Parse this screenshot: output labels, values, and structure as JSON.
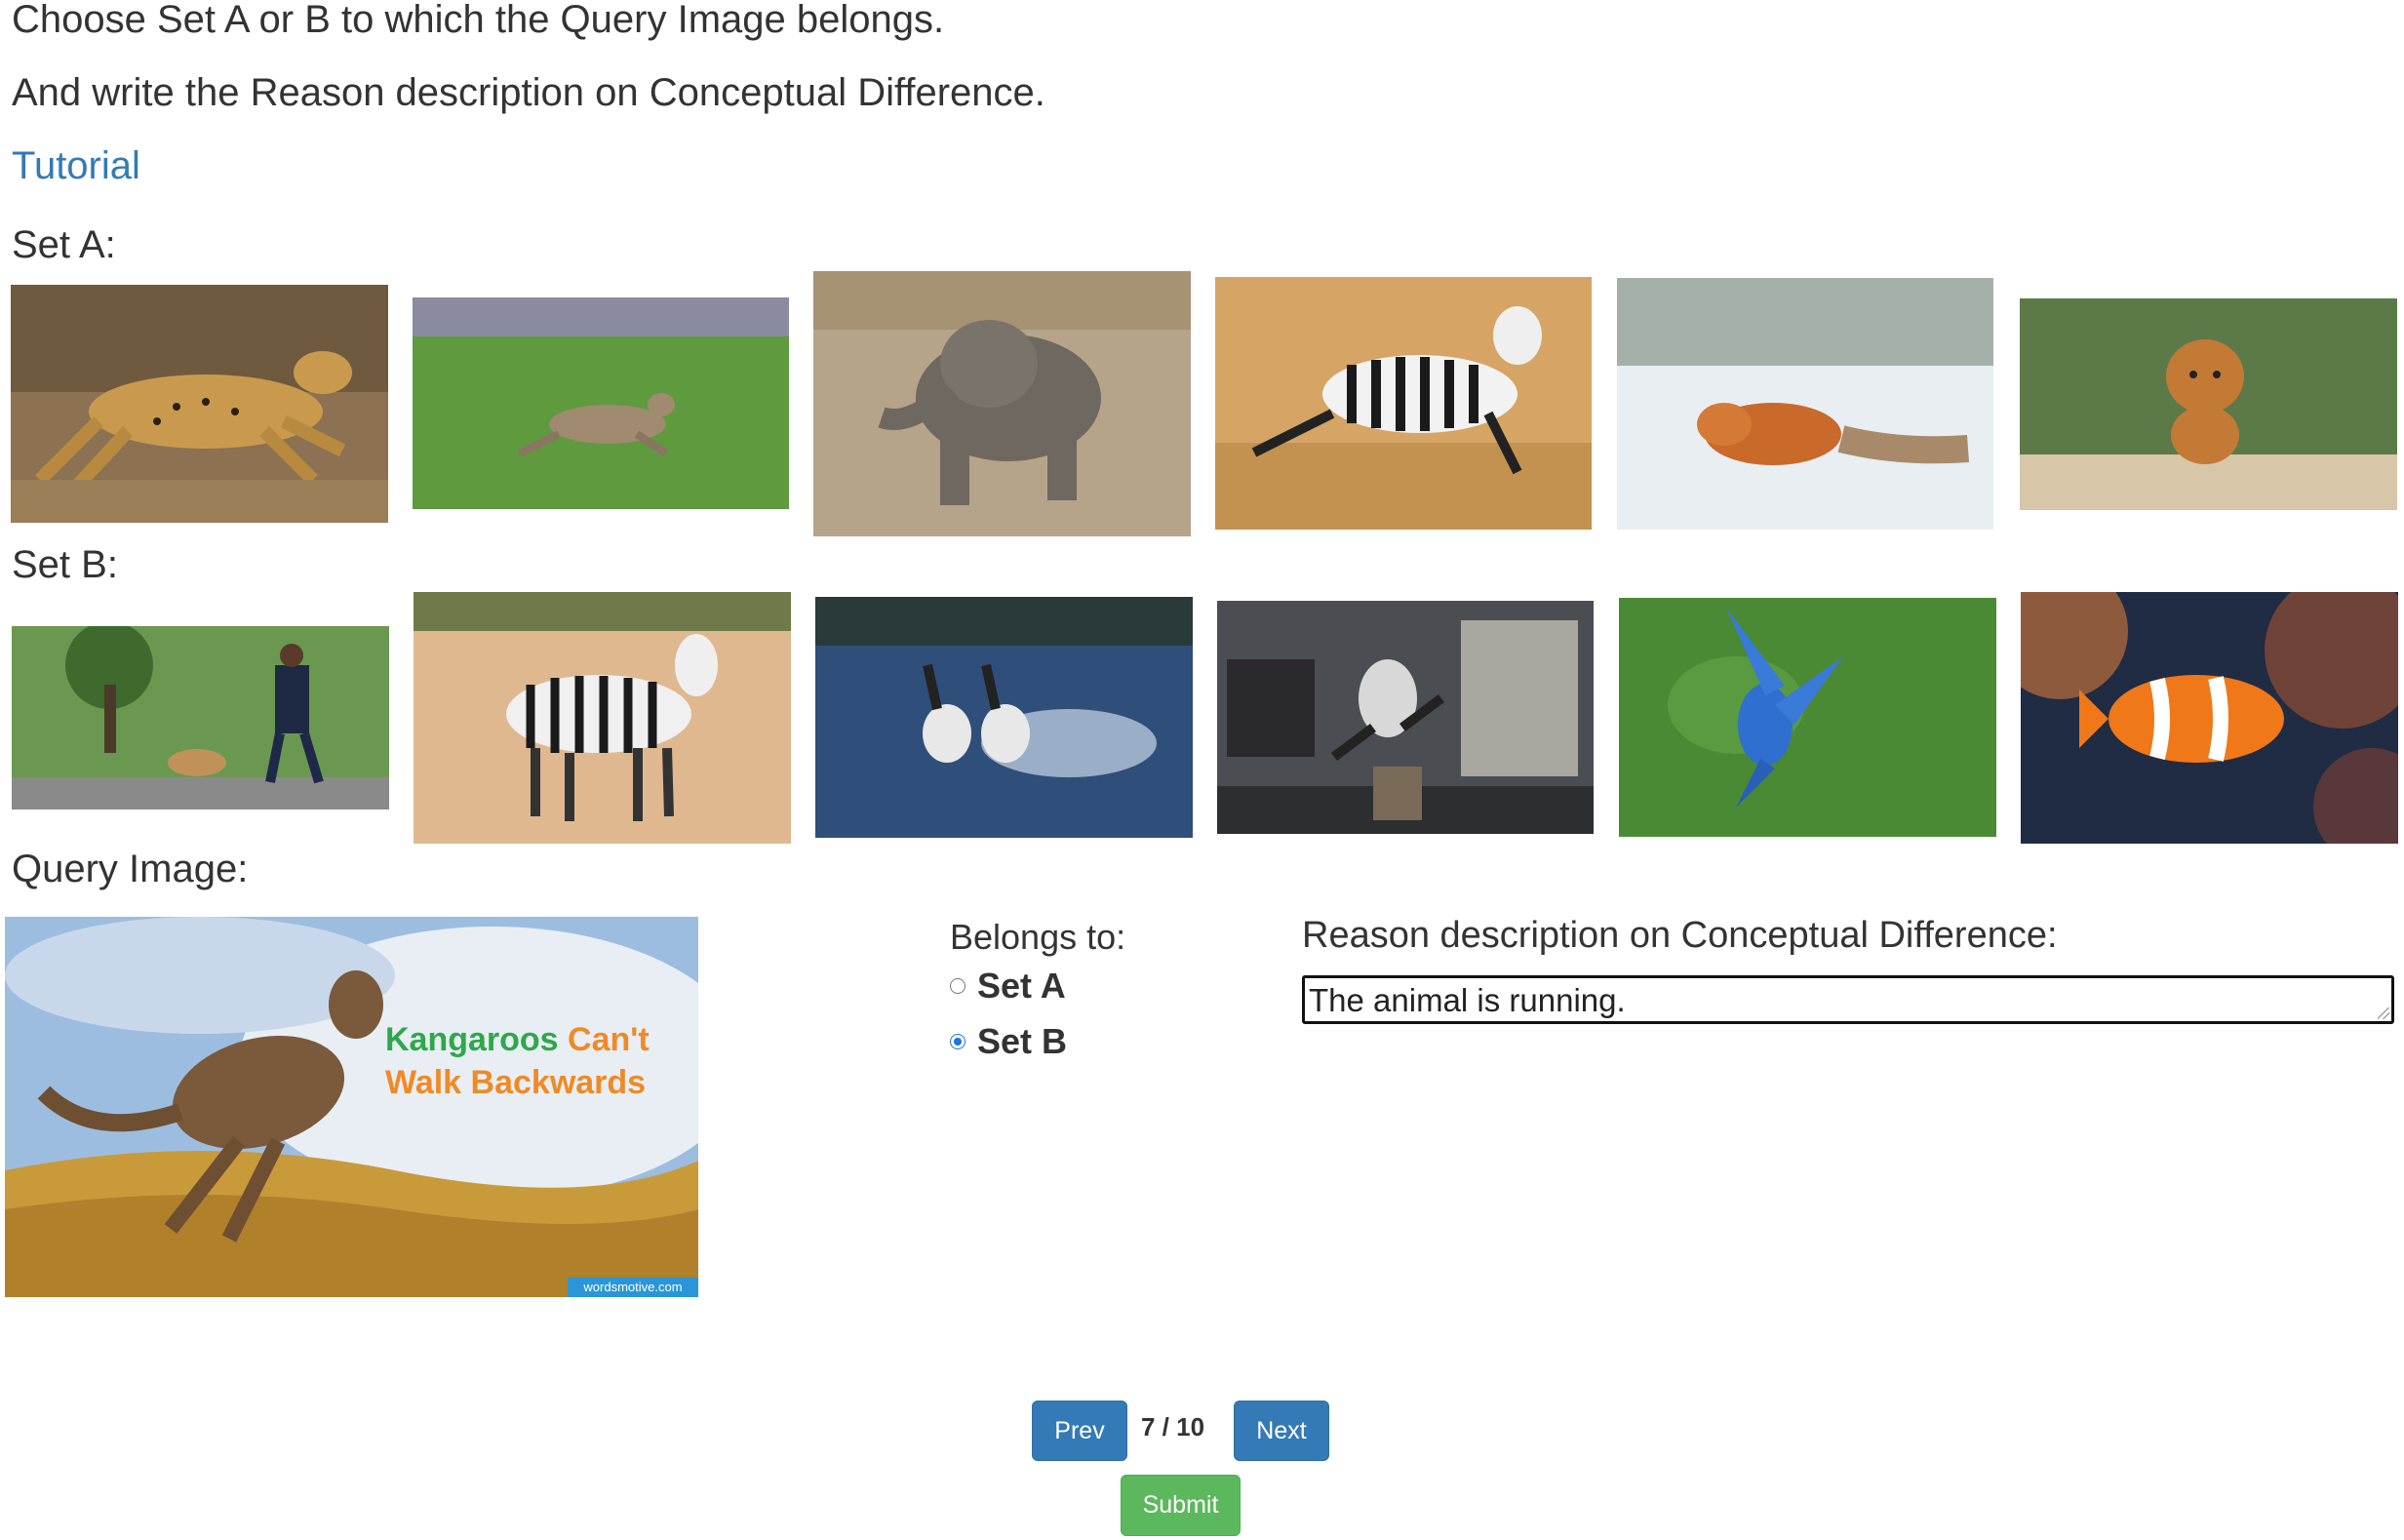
{
  "instructions": {
    "line1": "Choose Set A or B to which the Query Image belongs.",
    "line2": "And write the Reason description on Conceptual Difference."
  },
  "tutorial_link": "Tutorial",
  "set_a": {
    "label": "Set A:",
    "images": [
      "cheetah running",
      "deer running",
      "baby elephant running",
      "zebra leaping",
      "fox running in snow",
      "dog running"
    ]
  },
  "set_b": {
    "label": "Set B:",
    "images": [
      "woman walking dog",
      "zebra standing",
      "grebes running on water",
      "robot jumping",
      "blue bird flying",
      "clownfish swimming"
    ]
  },
  "query": {
    "label": "Query Image:",
    "image": "kangaroo hopping",
    "caption_line1_word1": "Kangaroos",
    "caption_line1_word2": "Can't",
    "caption_line2": "Walk Backwards",
    "watermark": "wordsmotive.com"
  },
  "belongs": {
    "label": "Belongs to:",
    "options": [
      "Set A",
      "Set B"
    ],
    "selected": "Set B"
  },
  "reason": {
    "label": "Reason description on Conceptual Difference:",
    "value": "The animal is running."
  },
  "pager": {
    "prev_label": "Prev",
    "next_label": "Next",
    "current": 7,
    "total": 10,
    "display": "7 / 10"
  },
  "submit_label": "Submit",
  "colors": {
    "link": "#337ab7",
    "button_blue": "#337ab7",
    "button_green": "#5cb85c",
    "radio_accent": "#1a73e8",
    "caption_green": "#2ea84a",
    "caption_orange": "#f08a24"
  }
}
